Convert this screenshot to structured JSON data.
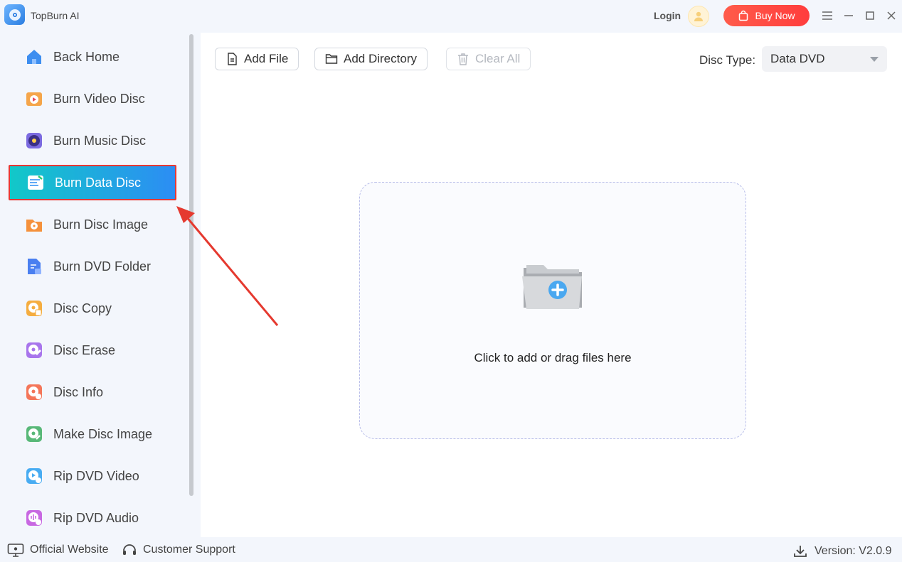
{
  "app": {
    "title": "TopBurn AI"
  },
  "header": {
    "login": "Login",
    "buy_now": "Buy Now"
  },
  "sidebar": {
    "items": [
      {
        "label": "Back Home",
        "icon": "home-icon",
        "color": "#3d8ef0"
      },
      {
        "label": "Burn Video Disc",
        "icon": "video-disc-icon",
        "color": "#f0a040"
      },
      {
        "label": "Burn Music Disc",
        "icon": "music-disc-icon",
        "color": "#6a5ad8"
      },
      {
        "label": "Burn Data Disc",
        "icon": "data-disc-icon",
        "color": "#ffffff",
        "active": true
      },
      {
        "label": "Burn Disc Image",
        "icon": "disc-image-icon",
        "color": "#f08a3c"
      },
      {
        "label": "Burn DVD Folder",
        "icon": "dvd-folder-icon",
        "color": "#4a7ff0"
      },
      {
        "label": "Disc Copy",
        "icon": "disc-copy-icon",
        "color": "#f0a83c"
      },
      {
        "label": "Disc Erase",
        "icon": "disc-erase-icon",
        "color": "#a070e8"
      },
      {
        "label": "Disc Info",
        "icon": "disc-info-icon",
        "color": "#f07050"
      },
      {
        "label": "Make Disc Image",
        "icon": "make-disc-image-icon",
        "color": "#50b070"
      },
      {
        "label": "Rip DVD Video",
        "icon": "rip-video-icon",
        "color": "#40a8f0"
      },
      {
        "label": "Rip DVD Audio",
        "icon": "rip-audio-icon",
        "color": "#c060e0"
      }
    ]
  },
  "toolbar": {
    "add_file": "Add File",
    "add_directory": "Add Directory",
    "clear_all": "Clear All",
    "disc_type_label": "Disc Type:",
    "disc_type_value": "Data DVD"
  },
  "dropzone": {
    "text": "Click to add or drag files here"
  },
  "footer": {
    "official_website": "Official Website",
    "customer_support": "Customer Support",
    "version": "Version: V2.0.9"
  },
  "colors": {
    "accent": "#2c8df4",
    "buy_now": "#ff4b3e",
    "highlight_border": "#e53935"
  }
}
